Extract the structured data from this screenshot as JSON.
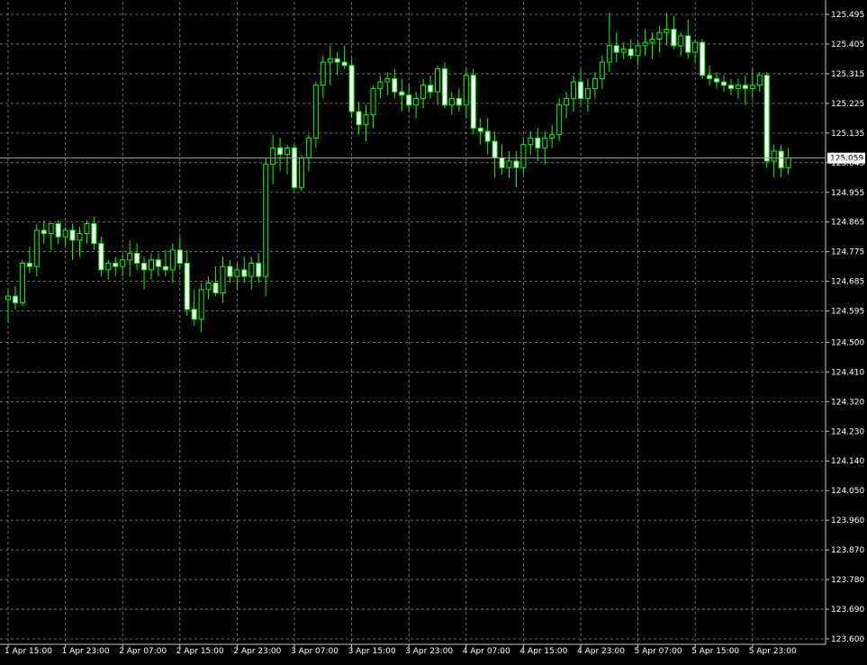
{
  "window": {
    "background": "#000000",
    "grid_color": "#8a8a8a",
    "axis_color": "#c8c8c8",
    "bull_color": "#000000",
    "bull_outline": "#00ff00",
    "bear_color": "#ffffff",
    "wick_color": "#00ff00",
    "text_color": "#ffffff",
    "current_line_color": "#9aa0a6"
  },
  "chart_data": {
    "type": "candlestick",
    "title": "",
    "xlabel": "",
    "ylabel": "",
    "grid": true,
    "price_axis": "right",
    "y_ticks": [
      "125.495",
      "125.405",
      "125.315",
      "125.225",
      "125.135",
      "125.045",
      "124.955",
      "124.865",
      "124.775",
      "124.685",
      "124.595",
      "124.500",
      "124.410",
      "124.320",
      "124.230",
      "124.140",
      "124.050",
      "123.960",
      "123.870",
      "123.780",
      "123.690",
      "123.600"
    ],
    "y_range": [
      123.6,
      125.495
    ],
    "current_price": "125.059",
    "x_ticks": [
      "1 Apr 15:00",
      "1 Apr 23:00",
      "2 Apr 07:00",
      "2 Apr 15:00",
      "2 Apr 23:00",
      "3 Apr 07:00",
      "3 Apr 15:00",
      "3 Apr 23:00",
      "4 Apr 07:00",
      "4 Apr 15:00",
      "4 Apr 23:00",
      "5 Apr 07:00",
      "5 Apr 15:00",
      "5 Apr 23:00"
    ],
    "bars_per_tick": 8,
    "candles": [
      [
        124.63,
        124.66,
        124.56,
        124.64
      ],
      [
        124.64,
        124.67,
        124.6,
        124.62
      ],
      [
        124.62,
        124.75,
        124.61,
        124.74
      ],
      [
        124.74,
        124.79,
        124.71,
        124.73
      ],
      [
        124.73,
        124.86,
        124.7,
        124.84
      ],
      [
        124.84,
        124.87,
        124.8,
        124.83
      ],
      [
        124.83,
        124.86,
        124.78,
        124.86
      ],
      [
        124.86,
        124.87,
        124.8,
        124.82
      ],
      [
        124.82,
        124.85,
        124.79,
        124.84
      ],
      [
        124.84,
        124.86,
        124.75,
        124.81
      ],
      [
        124.81,
        124.85,
        124.76,
        124.83
      ],
      [
        124.83,
        124.87,
        124.8,
        124.86
      ],
      [
        124.86,
        124.88,
        124.78,
        124.8
      ],
      [
        124.8,
        124.82,
        124.7,
        124.72
      ],
      [
        124.72,
        124.75,
        124.69,
        124.74
      ],
      [
        124.74,
        124.76,
        124.7,
        124.73
      ],
      [
        124.73,
        124.77,
        124.7,
        124.75
      ],
      [
        124.75,
        124.81,
        124.7,
        124.77
      ],
      [
        124.77,
        124.8,
        124.72,
        124.74
      ],
      [
        124.74,
        124.76,
        124.66,
        124.72
      ],
      [
        124.72,
        124.77,
        124.69,
        124.75
      ],
      [
        124.75,
        124.77,
        124.7,
        124.73
      ],
      [
        124.73,
        124.78,
        124.7,
        124.72
      ],
      [
        124.72,
        124.8,
        124.68,
        124.78
      ],
      [
        124.78,
        124.82,
        124.72,
        124.74
      ],
      [
        124.74,
        124.78,
        124.58,
        124.6
      ],
      [
        124.6,
        124.66,
        124.55,
        124.57
      ],
      [
        124.57,
        124.68,
        124.53,
        124.66
      ],
      [
        124.66,
        124.7,
        124.63,
        124.68
      ],
      [
        124.68,
        124.73,
        124.64,
        124.65
      ],
      [
        124.65,
        124.76,
        124.62,
        124.73
      ],
      [
        124.73,
        124.75,
        124.68,
        124.7
      ],
      [
        124.7,
        124.74,
        124.66,
        124.72
      ],
      [
        124.72,
        124.76,
        124.68,
        124.7
      ],
      [
        124.7,
        124.76,
        124.66,
        124.74
      ],
      [
        124.74,
        124.77,
        124.68,
        124.7
      ],
      [
        124.7,
        125.06,
        124.64,
        125.04
      ],
      [
        125.04,
        125.13,
        124.98,
        125.09
      ],
      [
        125.09,
        125.12,
        125.02,
        125.07
      ],
      [
        125.07,
        125.1,
        125.01,
        125.09
      ],
      [
        125.09,
        125.1,
        124.96,
        124.97
      ],
      [
        124.97,
        125.07,
        124.96,
        125.06
      ],
      [
        125.06,
        125.13,
        125.02,
        125.12
      ],
      [
        125.12,
        125.29,
        125.09,
        125.28
      ],
      [
        125.28,
        125.37,
        125.24,
        125.35
      ],
      [
        125.35,
        125.4,
        125.28,
        125.36
      ],
      [
        125.36,
        125.38,
        125.31,
        125.35
      ],
      [
        125.35,
        125.4,
        125.33,
        125.34
      ],
      [
        125.34,
        125.36,
        125.18,
        125.2
      ],
      [
        125.2,
        125.23,
        125.13,
        125.16
      ],
      [
        125.16,
        125.22,
        125.11,
        125.19
      ],
      [
        125.19,
        125.28,
        125.15,
        125.27
      ],
      [
        125.27,
        125.31,
        125.24,
        125.29
      ],
      [
        125.29,
        125.32,
        125.25,
        125.3
      ],
      [
        125.3,
        125.33,
        125.24,
        125.26
      ],
      [
        125.26,
        125.3,
        125.2,
        125.25
      ],
      [
        125.25,
        125.28,
        125.2,
        125.22
      ],
      [
        125.22,
        125.26,
        125.18,
        125.24
      ],
      [
        125.24,
        125.3,
        125.21,
        125.28
      ],
      [
        125.28,
        125.31,
        125.24,
        125.26
      ],
      [
        125.26,
        125.34,
        125.22,
        125.33
      ],
      [
        125.33,
        125.35,
        125.21,
        125.22
      ],
      [
        125.22,
        125.26,
        125.19,
        125.24
      ],
      [
        125.24,
        125.27,
        125.2,
        125.22
      ],
      [
        125.22,
        125.33,
        125.18,
        125.31
      ],
      [
        125.31,
        125.33,
        125.13,
        125.15
      ],
      [
        125.15,
        125.18,
        125.1,
        125.14
      ],
      [
        125.14,
        125.18,
        125.07,
        125.11
      ],
      [
        125.11,
        125.14,
        125.0,
        125.06
      ],
      [
        125.06,
        125.1,
        125.01,
        125.03
      ],
      [
        125.03,
        125.08,
        125.0,
        125.05
      ],
      [
        125.05,
        125.08,
        124.97,
        125.03
      ],
      [
        125.03,
        125.12,
        125.01,
        125.1
      ],
      [
        125.1,
        125.14,
        125.07,
        125.12
      ],
      [
        125.12,
        125.15,
        125.05,
        125.09
      ],
      [
        125.09,
        125.14,
        125.04,
        125.12
      ],
      [
        125.12,
        125.16,
        125.09,
        125.13
      ],
      [
        125.13,
        125.24,
        125.11,
        125.22
      ],
      [
        125.22,
        125.26,
        125.18,
        125.24
      ],
      [
        125.24,
        125.31,
        125.2,
        125.29
      ],
      [
        125.29,
        125.33,
        125.22,
        125.24
      ],
      [
        125.24,
        125.3,
        125.2,
        125.27
      ],
      [
        125.27,
        125.32,
        125.24,
        125.3
      ],
      [
        125.3,
        125.37,
        125.27,
        125.35
      ],
      [
        125.35,
        125.5,
        125.32,
        125.4
      ],
      [
        125.4,
        125.44,
        125.35,
        125.38
      ],
      [
        125.38,
        125.41,
        125.36,
        125.39
      ],
      [
        125.39,
        125.42,
        125.36,
        125.37
      ],
      [
        125.37,
        125.41,
        125.34,
        125.4
      ],
      [
        125.4,
        125.45,
        125.37,
        125.41
      ],
      [
        125.41,
        125.44,
        125.36,
        125.42
      ],
      [
        125.42,
        125.46,
        125.38,
        125.44
      ],
      [
        125.44,
        125.5,
        125.4,
        125.45
      ],
      [
        125.45,
        125.49,
        125.39,
        125.4
      ],
      [
        125.4,
        125.44,
        125.37,
        125.43
      ],
      [
        125.43,
        125.48,
        125.36,
        125.38
      ],
      [
        125.38,
        125.42,
        125.35,
        125.41
      ],
      [
        125.41,
        125.42,
        125.3,
        125.31
      ],
      [
        125.31,
        125.34,
        125.28,
        125.3
      ],
      [
        125.3,
        125.32,
        125.27,
        125.29
      ],
      [
        125.29,
        125.31,
        125.26,
        125.28
      ],
      [
        125.28,
        125.3,
        125.25,
        125.27
      ],
      [
        125.27,
        125.3,
        125.24,
        125.28
      ],
      [
        125.28,
        125.31,
        125.22,
        125.27
      ],
      [
        125.27,
        125.33,
        125.24,
        125.28
      ],
      [
        125.28,
        125.32,
        125.26,
        125.31
      ],
      [
        125.31,
        125.32,
        125.03,
        125.05
      ],
      [
        125.05,
        125.1,
        125.0,
        125.08
      ],
      [
        125.08,
        125.1,
        125.0,
        125.03
      ],
      [
        125.03,
        125.09,
        125.01,
        125.059
      ]
    ]
  }
}
